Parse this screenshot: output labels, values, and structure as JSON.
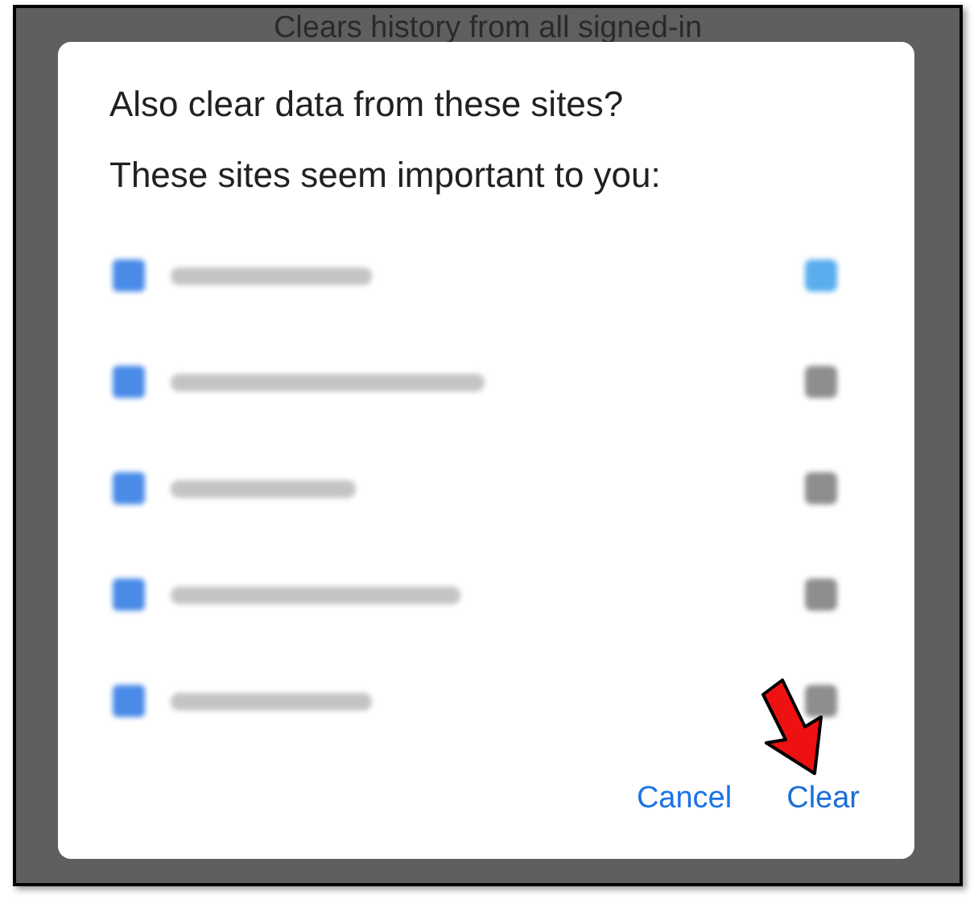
{
  "background_text": "Clears history from all signed-in",
  "dialog": {
    "title": "Also clear data from these sites?",
    "subtitle": "These sites seem important to you:",
    "sites": [
      {
        "checked": true
      },
      {
        "checked": false
      },
      {
        "checked": false
      },
      {
        "checked": false
      },
      {
        "checked": false
      }
    ],
    "buttons": [
      {
        "label": "Cancel",
        "kind": "cancel"
      },
      {
        "label": "Clear",
        "kind": "confirm"
      }
    ],
    "annotation": {
      "kind": "arrow"
    }
  }
}
